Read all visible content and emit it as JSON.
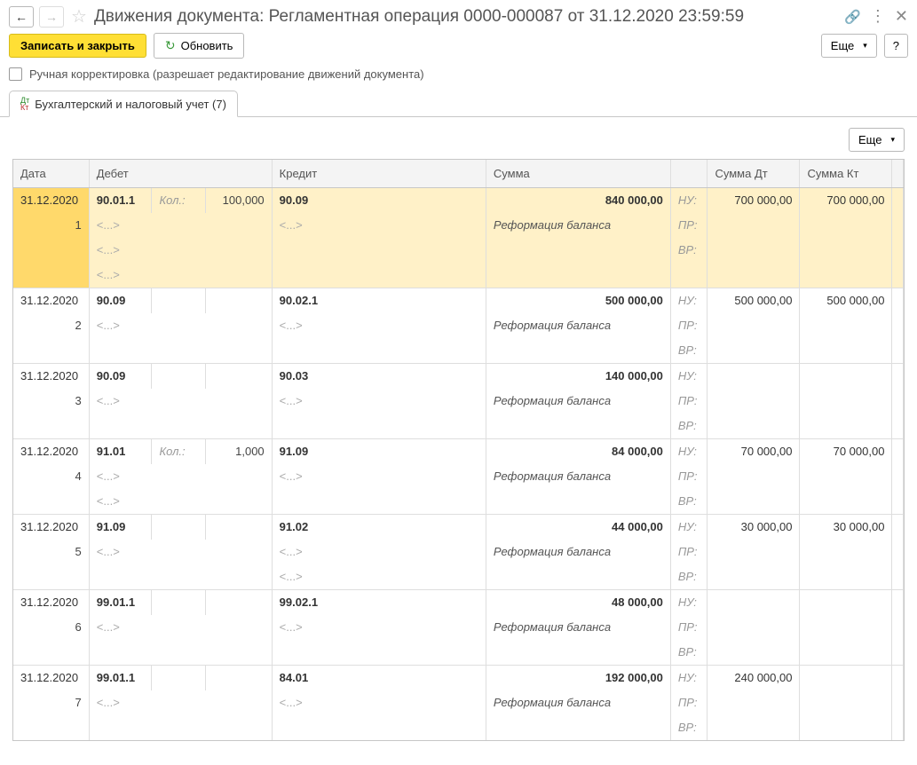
{
  "header": {
    "title": "Движения документа: Регламентная операция 0000-000087 от 31.12.2020 23:59:59"
  },
  "toolbar": {
    "save_close": "Записать и закрыть",
    "refresh": "Обновить",
    "more": "Еще",
    "help": "?"
  },
  "checkbox": {
    "label": "Ручная корректировка (разрешает редактирование движений документа)"
  },
  "tab": {
    "label": "Бухгалтерский и налоговый учет (7)"
  },
  "grid_toolbar": {
    "more": "Еще"
  },
  "columns": {
    "date": "Дата",
    "debit": "Дебет",
    "credit": "Кредит",
    "sum": "Сумма",
    "sum_dt": "Сумма Дт",
    "sum_kt": "Сумма Кт"
  },
  "placeholders": {
    "sub": "<...>",
    "kol": "Кол.:"
  },
  "tags": {
    "nu": "НУ:",
    "pr": "ПР:",
    "vr": "ВР:"
  },
  "rows": [
    {
      "date": "31.12.2020",
      "num": "1",
      "debit_acc": "90.01.1",
      "debit_kol": true,
      "debit_qty": "100,000",
      "credit_acc": "90.09",
      "amount": "840 000,00",
      "desc": "Реформация баланса",
      "sum_dt": "700 000,00",
      "sum_kt": "700 000,00",
      "debit_sub_rows": 3,
      "credit_sub_rows": 1,
      "selected": true
    },
    {
      "date": "31.12.2020",
      "num": "2",
      "debit_acc": "90.09",
      "debit_kol": false,
      "debit_qty": "",
      "credit_acc": "90.02.1",
      "amount": "500 000,00",
      "desc": "Реформация баланса",
      "sum_dt": "500 000,00",
      "sum_kt": "500 000,00",
      "debit_sub_rows": 1,
      "credit_sub_rows": 1
    },
    {
      "date": "31.12.2020",
      "num": "3",
      "debit_acc": "90.09",
      "debit_kol": false,
      "debit_qty": "",
      "credit_acc": "90.03",
      "amount": "140 000,00",
      "desc": "Реформация баланса",
      "sum_dt": "",
      "sum_kt": "",
      "debit_sub_rows": 1,
      "credit_sub_rows": 1
    },
    {
      "date": "31.12.2020",
      "num": "4",
      "debit_acc": "91.01",
      "debit_kol": true,
      "debit_qty": "1,000",
      "credit_acc": "91.09",
      "amount": "84 000,00",
      "desc": "Реформация баланса",
      "sum_dt": "70 000,00",
      "sum_kt": "70 000,00",
      "debit_sub_rows": 2,
      "credit_sub_rows": 1
    },
    {
      "date": "31.12.2020",
      "num": "5",
      "debit_acc": "91.09",
      "debit_kol": false,
      "debit_qty": "",
      "credit_acc": "91.02",
      "amount": "44 000,00",
      "desc": "Реформация баланса",
      "sum_dt": "30 000,00",
      "sum_kt": "30 000,00",
      "debit_sub_rows": 1,
      "credit_sub_rows": 2
    },
    {
      "date": "31.12.2020",
      "num": "6",
      "debit_acc": "99.01.1",
      "debit_kol": false,
      "debit_qty": "",
      "credit_acc": "99.02.1",
      "amount": "48 000,00",
      "desc": "Реформация баланса",
      "sum_dt": "",
      "sum_kt": "",
      "debit_sub_rows": 1,
      "credit_sub_rows": 1
    },
    {
      "date": "31.12.2020",
      "num": "7",
      "debit_acc": "99.01.1",
      "debit_kol": false,
      "debit_qty": "",
      "credit_acc": "84.01",
      "amount": "192 000,00",
      "desc": "Реформация баланса",
      "sum_dt": "240 000,00",
      "sum_kt": "",
      "debit_sub_rows": 1,
      "credit_sub_rows": 1
    }
  ]
}
